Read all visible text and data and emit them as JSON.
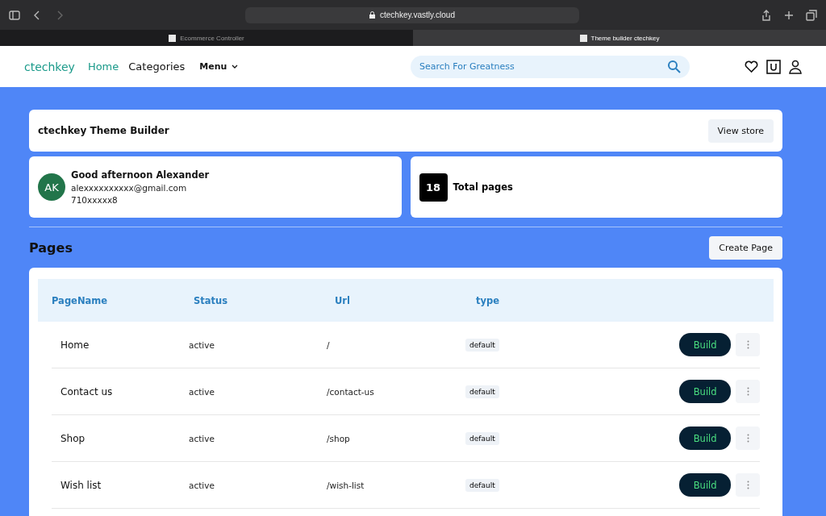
{
  "browser": {
    "url": "ctechkey.vastly.cloud",
    "tabs": [
      {
        "label": "Ecommerce Controller",
        "selected": false
      },
      {
        "label": "Theme builder ctechkey",
        "selected": true
      }
    ]
  },
  "site_header": {
    "logo": "ctechkey",
    "nav": [
      {
        "label": "Home",
        "selected": true
      },
      {
        "label": "Categories",
        "selected": false
      },
      {
        "label": "Menu",
        "selected": false
      }
    ],
    "search": {
      "placeholder": "Search For Greatness"
    }
  },
  "builder_card": {
    "title": "ctechkey Theme Builder",
    "button": "View store"
  },
  "user_card": {
    "initials": "AK",
    "greeting": "Good afternoon Alexander",
    "email": "alexxxxxxxxxx@gmail.com",
    "phone": "710xxxxx8"
  },
  "stats_card": {
    "count": "18",
    "label": "Total pages"
  },
  "pages": {
    "title": "Pages",
    "button": "Create Page",
    "columns": [
      "PageName",
      "Status",
      "Url",
      "type"
    ],
    "rows": [
      {
        "name": "Home",
        "status": "active",
        "url": "/",
        "type": "default",
        "action": "Build"
      },
      {
        "name": "Contact us",
        "status": "active",
        "url": "/contact-us",
        "type": "default",
        "action": "Build"
      },
      {
        "name": "Shop",
        "status": "active",
        "url": "/shop",
        "type": "default",
        "action": "Build"
      },
      {
        "name": "Wish list",
        "status": "active",
        "url": "/wish-list",
        "type": "default",
        "action": "Build"
      }
    ]
  }
}
